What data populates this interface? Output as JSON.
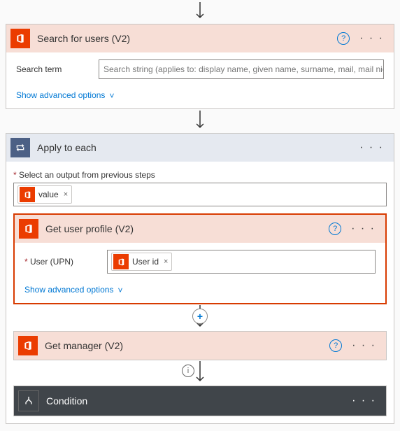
{
  "arrow_glyph": "↓",
  "search_users": {
    "title": "Search for users (V2)",
    "field_label": "Search term",
    "placeholder": "Search string (applies to: display name, given name, surname, mail, mail nickna",
    "advanced": "Show advanced options"
  },
  "apply_each": {
    "title": "Apply to each",
    "select_label": "Select an output from previous steps",
    "token": "value"
  },
  "get_profile": {
    "title": "Get user profile (V2)",
    "field_label": "User (UPN)",
    "token": "User id",
    "advanced": "Show advanced options"
  },
  "get_manager": {
    "title": "Get manager (V2)"
  },
  "condition": {
    "title": "Condition"
  },
  "glyphs": {
    "help": "?",
    "ellipsis": "· · ·",
    "plus": "+",
    "info": "i",
    "close": "×",
    "chev_down": "˅"
  }
}
